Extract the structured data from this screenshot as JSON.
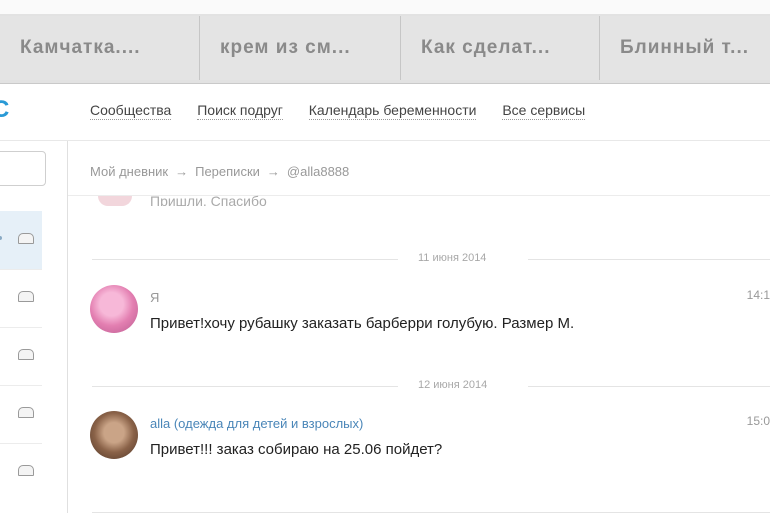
{
  "browser_tabs": [
    {
      "label": "Камчатка...."
    },
    {
      "label": "крем из см..."
    },
    {
      "label": "Как сделат..."
    },
    {
      "label": "Блинный т..."
    }
  ],
  "header": {
    "logo_fragment": "C",
    "nav": [
      {
        "label": "Сообщества"
      },
      {
        "label": "Поиск подруг"
      },
      {
        "label": "Календарь беременности"
      },
      {
        "label": "Все сервисы"
      }
    ]
  },
  "breadcrumb": {
    "items": [
      "Мой дневник",
      "Переписки",
      "@alla8888"
    ],
    "separator": "→"
  },
  "previous_message_fragment": "Пришли. Спасибо",
  "conversation": [
    {
      "date": "11 июня 2014",
      "author": "Я",
      "time": "14:1",
      "text": "Привет!хочу рубашку заказать барберри голубую. Размер М.",
      "avatar": "avatar-pink"
    },
    {
      "date": "12 июня 2014",
      "author": "alla (одежда для детей и взрослых)",
      "time": "15:0",
      "text": "Привет!!! заказ собираю на 25.06 пойдет?",
      "avatar": "avatar-brown"
    }
  ],
  "icons": {
    "sidebar_item": "envelope-icon"
  },
  "colors": {
    "accent": "#2a9ad6",
    "author_link": "#4a86b8",
    "active_row": "#e6f0f8"
  }
}
